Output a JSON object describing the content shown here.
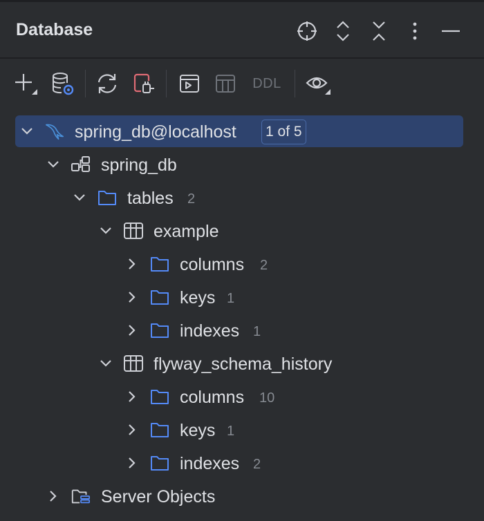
{
  "header": {
    "title": "Database",
    "actions": [
      {
        "name": "locate-icon"
      },
      {
        "name": "expand-all-icon"
      },
      {
        "name": "collapse-all-icon"
      },
      {
        "name": "more-options-icon"
      },
      {
        "name": "minimize-icon"
      }
    ]
  },
  "toolbar": {
    "items": [
      "add-icon",
      "data-source-properties-icon",
      "refresh-icon",
      "disconnect-icon",
      "jump-to-console-icon",
      "table-view-icon",
      "ddl-label",
      "view-options-icon"
    ],
    "ddl_label": "DDL"
  },
  "tree": {
    "datasource": {
      "label": "spring_db@localhost",
      "badge": "1 of 5"
    },
    "schema": {
      "label": "spring_db"
    },
    "tables": {
      "label": "tables",
      "count": "2"
    },
    "example": {
      "label": "example",
      "columns": {
        "label": "columns",
        "count": "2"
      },
      "keys": {
        "label": "keys",
        "count": "1"
      },
      "indexes": {
        "label": "indexes",
        "count": "1"
      }
    },
    "flyway": {
      "label": "flyway_schema_history",
      "columns": {
        "label": "columns",
        "count": "10"
      },
      "keys": {
        "label": "keys",
        "count": "1"
      },
      "indexes": {
        "label": "indexes",
        "count": "2"
      }
    },
    "server_objects": {
      "label": "Server Objects"
    }
  },
  "colors": {
    "background": "#2b2d30",
    "selection": "#2e436e",
    "folder": "#548af7",
    "text": "#dfe1e5",
    "muted": "#868a91",
    "disconnect": "#e06c75"
  }
}
